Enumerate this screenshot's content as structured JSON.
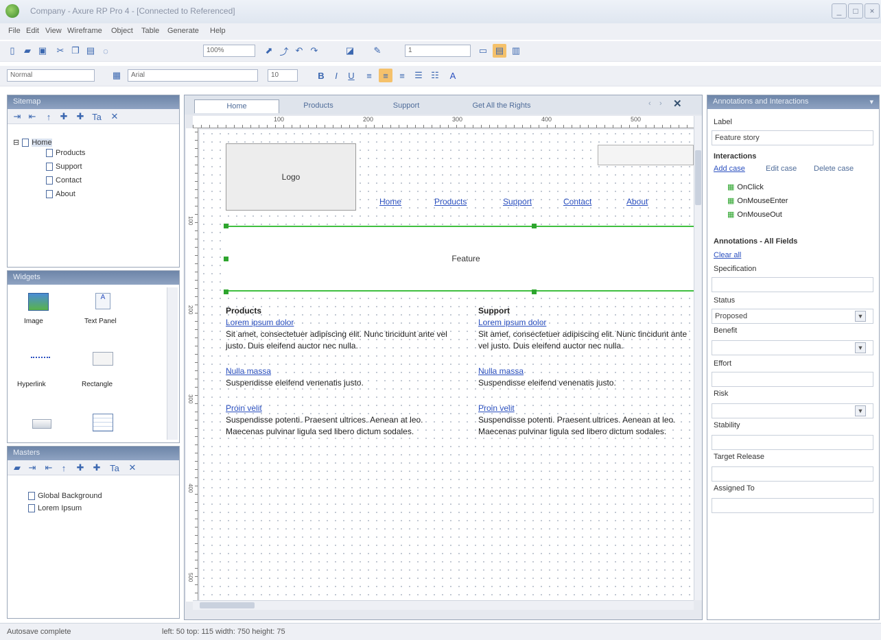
{
  "window": {
    "title": "Company - Axure RP Pro 4 - [Connected to Referenced]",
    "minimize": "_",
    "maximize": "□",
    "close": "×"
  },
  "menu": [
    "File",
    "Edit",
    "View",
    "Wireframe",
    "Object",
    "Table",
    "Generate",
    "Help"
  ],
  "toolbar1": {
    "zoom": "100%",
    "line_weight": "1"
  },
  "toolbar2": {
    "style": "Normal",
    "font": "Arial",
    "size": "10"
  },
  "sitemap": {
    "title": "Sitemap",
    "root": "Home",
    "children": [
      "Products",
      "Support",
      "Contact",
      "About"
    ]
  },
  "widgets": {
    "title": "Widgets",
    "items": [
      {
        "label": "Image",
        "icon": "image-icon"
      },
      {
        "label": "Text Panel",
        "icon": "text-panel-icon"
      },
      {
        "label": "Hyperlink",
        "icon": "hyperlink-icon"
      },
      {
        "label": "Rectangle",
        "icon": "rectangle-icon"
      },
      {
        "label": "",
        "icon": "button-icon"
      },
      {
        "label": "",
        "icon": "table-icon"
      }
    ]
  },
  "masters": {
    "title": "Masters",
    "items": [
      "Global Background",
      "Lorem Ipsum"
    ]
  },
  "tabs": [
    "Home",
    "Products",
    "Support",
    "Get All the Rights"
  ],
  "ruler": {
    "ticks": [
      "100",
      "200",
      "300",
      "400",
      "500"
    ],
    "vticks": [
      "100",
      "200",
      "300",
      "400",
      "500"
    ]
  },
  "canvas": {
    "logo": "Logo",
    "nav": [
      "Home",
      "Products",
      "Support",
      "Contact",
      "About"
    ],
    "feature": "Feature",
    "col1": {
      "heading": "Products",
      "link1": "Lorem ipsum dolor",
      "text1": "Sit amet, consectetuer adipiscing elit. Nunc tincidunt ante vel justo. Duis eleifend auctor nec nulla.",
      "link2": "Nulla massa",
      "text2": "Suspendisse eleifend venenatis justo.",
      "link3": "Proin velit",
      "text3": "Suspendisse potenti. Praesent ultrices. Aenean at leo. Maecenas pulvinar ligula sed libero dictum sodales."
    },
    "col2": {
      "heading": "Support",
      "link1": "Lorem ipsum dolor",
      "text1": "Sit amet, consectetuer adipiscing elit. Nunc tincidunt ante vel justo. Duis eleifend auctor nec nulla.",
      "link2": "Nulla massa",
      "text2": "Suspendisse eleifend venenatis justo.",
      "link3": "Proin velit",
      "text3": "Suspendisse potenti. Praesent ultrices. Aenean at leo. Maecenas pulvinar ligula sed libero dictum sodales."
    }
  },
  "annotations": {
    "title": "Annotations and Interactions",
    "label_caption": "Label",
    "label_value": "Feature story",
    "interactions_caption": "Interactions",
    "add_case": "Add case",
    "edit_case": "Edit case",
    "delete_case": "Delete case",
    "events": [
      "OnClick",
      "OnMouseEnter",
      "OnMouseOut"
    ],
    "annotations_caption": "Annotations - All Fields",
    "clear_all": "Clear all",
    "fields": [
      "Specification",
      "Status",
      "Benefit",
      "Effort",
      "Risk",
      "Stability",
      "Target Release",
      "Assigned To"
    ],
    "status_value": "Proposed"
  },
  "statusbar": {
    "left": "Autosave complete",
    "info": "left: 50  top: 115  width: 750  height: 75"
  }
}
